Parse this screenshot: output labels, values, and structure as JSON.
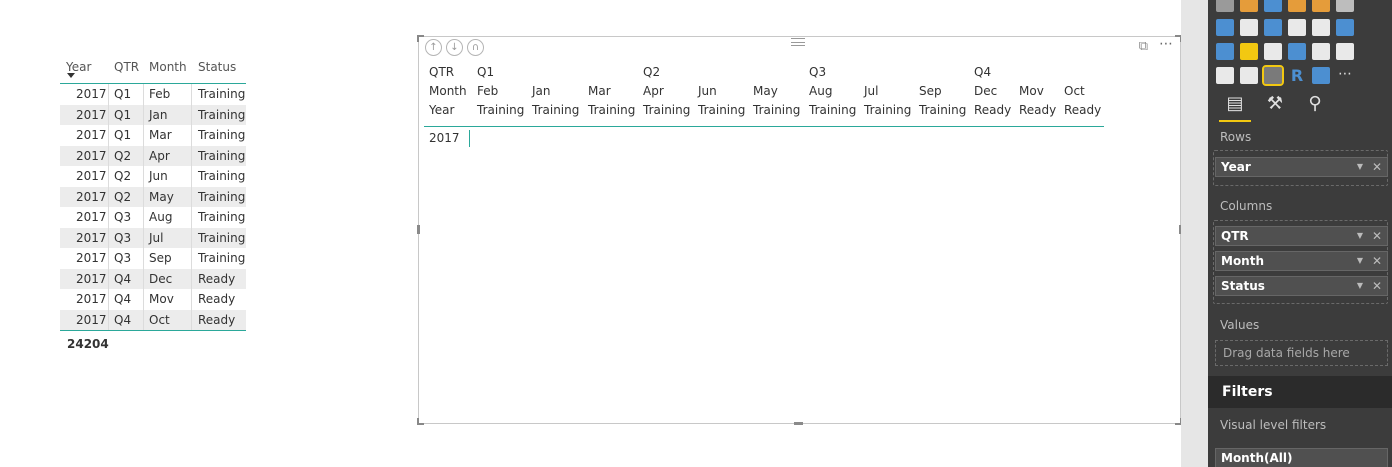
{
  "left_table": {
    "headers": {
      "year": "Year",
      "qtr": "QTR",
      "month": "Month",
      "status": "Status"
    },
    "rows": [
      {
        "year": "2017",
        "qtr": "Q1",
        "month": "Feb",
        "status": "Training"
      },
      {
        "year": "2017",
        "qtr": "Q1",
        "month": "Jan",
        "status": "Training"
      },
      {
        "year": "2017",
        "qtr": "Q1",
        "month": "Mar",
        "status": "Training"
      },
      {
        "year": "2017",
        "qtr": "Q2",
        "month": "Apr",
        "status": "Training"
      },
      {
        "year": "2017",
        "qtr": "Q2",
        "month": "Jun",
        "status": "Training"
      },
      {
        "year": "2017",
        "qtr": "Q2",
        "month": "May",
        "status": "Training"
      },
      {
        "year": "2017",
        "qtr": "Q3",
        "month": "Aug",
        "status": "Training"
      },
      {
        "year": "2017",
        "qtr": "Q3",
        "month": "Jul",
        "status": "Training"
      },
      {
        "year": "2017",
        "qtr": "Q3",
        "month": "Sep",
        "status": "Training"
      },
      {
        "year": "2017",
        "qtr": "Q4",
        "month": "Dec",
        "status": "Ready"
      },
      {
        "year": "2017",
        "qtr": "Q4",
        "month": "Mov",
        "status": "Ready"
      },
      {
        "year": "2017",
        "qtr": "Q4",
        "month": "Oct",
        "status": "Ready"
      }
    ],
    "total": "24204"
  },
  "matrix": {
    "row_headers": {
      "qtr": "QTR",
      "month": "Month",
      "year": "Year"
    },
    "quarters": [
      "Q1",
      "Q2",
      "Q3",
      "Q4"
    ],
    "columns": [
      {
        "month": "Feb",
        "status": "Training"
      },
      {
        "month": "Jan",
        "status": "Training"
      },
      {
        "month": "Mar",
        "status": "Training"
      },
      {
        "month": "Apr",
        "status": "Training"
      },
      {
        "month": "Jun",
        "status": "Training"
      },
      {
        "month": "May",
        "status": "Training"
      },
      {
        "month": "Aug",
        "status": "Training"
      },
      {
        "month": "Jul",
        "status": "Training"
      },
      {
        "month": "Sep",
        "status": "Training"
      },
      {
        "month": "Dec",
        "status": "Ready"
      },
      {
        "month": "Mov",
        "status": "Ready"
      },
      {
        "month": "Oct",
        "status": "Ready"
      }
    ],
    "row_value": "2017",
    "more_label": "⋯"
  },
  "pane": {
    "rows_label": "Rows",
    "rows_field": "Year",
    "columns_label": "Columns",
    "column_fields": [
      "QTR",
      "Month",
      "Status"
    ],
    "values_label": "Values",
    "values_hint": "Drag data fields here",
    "filters_label": "Filters",
    "visual_filters_label": "Visual level filters",
    "filter_field": "Month(All)",
    "accent_color": "#f2c811"
  },
  "colors": {
    "table_accent": "#2ba89a",
    "pane_bg": "#3c3c3c"
  }
}
